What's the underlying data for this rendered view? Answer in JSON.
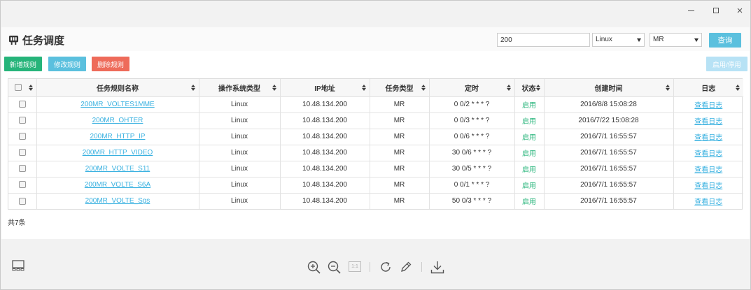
{
  "window": {
    "minimize": "minimize",
    "maximize": "maximize",
    "close": "×"
  },
  "page": {
    "title": "任务调度"
  },
  "search": {
    "value": "200",
    "os_select": "Linux",
    "type_select": "MR",
    "query_label": "查询"
  },
  "actions": {
    "add_label": "新增规则",
    "edit_label": "修改规则",
    "delete_label": "删除规则",
    "toggle_label": "启用/停用"
  },
  "table": {
    "headers": [
      "任务规则名称",
      "操作系统类型",
      "IP地址",
      "任务类型",
      "定时",
      "状态",
      "创建时间",
      "日志"
    ],
    "rows": [
      {
        "name": "200MR_VOLTES1MME",
        "os": "Linux",
        "ip": "10.48.134.200",
        "type": "MR",
        "cron": "0 0/2 * * * ?",
        "status": "启用",
        "created": "2016/8/8 15:08:28",
        "log": "查看日志"
      },
      {
        "name": "200MR_OHTER",
        "os": "Linux",
        "ip": "10.48.134.200",
        "type": "MR",
        "cron": "0 0/3 * * * ?",
        "status": "启用",
        "created": "2016/7/22 15:08:28",
        "log": "查看日志"
      },
      {
        "name": "200MR_HTTP_IP",
        "os": "Linux",
        "ip": "10.48.134.200",
        "type": "MR",
        "cron": "0 0/6 * * * ?",
        "status": "启用",
        "created": "2016/7/1 16:55:57",
        "log": "查看日志"
      },
      {
        "name": "200MR_HTTP_VIDEO",
        "os": "Linux",
        "ip": "10.48.134.200",
        "type": "MR",
        "cron": "30 0/6 * * * ?",
        "status": "启用",
        "created": "2016/7/1 16:55:57",
        "log": "查看日志"
      },
      {
        "name": "200MR_VOLTE_S11",
        "os": "Linux",
        "ip": "10.48.134.200",
        "type": "MR",
        "cron": "30 0/5 * * * ?",
        "status": "启用",
        "created": "2016/7/1 16:55:57",
        "log": "查看日志"
      },
      {
        "name": "200MR_VOLTE_S6A",
        "os": "Linux",
        "ip": "10.48.134.200",
        "type": "MR",
        "cron": "0 0/1 * * * ?",
        "status": "启用",
        "created": "2016/7/1 16:55:57",
        "log": "查看日志"
      },
      {
        "name": "200MR_VOLTE_Sgs",
        "os": "Linux",
        "ip": "10.48.134.200",
        "type": "MR",
        "cron": "50 0/3 * * * ?",
        "status": "启用",
        "created": "2016/7/1 16:55:57",
        "log": "查看日志"
      }
    ],
    "total_label": "共7条"
  },
  "viewer_toolbar": {
    "actual_size_label": "1:1",
    "icons": [
      "layout-icon",
      "zoom-in-icon",
      "zoom-out-icon",
      "actual-size-icon",
      "rotate-icon",
      "edit-icon",
      "download-icon"
    ]
  },
  "colors": {
    "green": "#26b47a",
    "blue": "#5bc0de",
    "red": "#ee6b5a",
    "link": "#39b1e0"
  }
}
